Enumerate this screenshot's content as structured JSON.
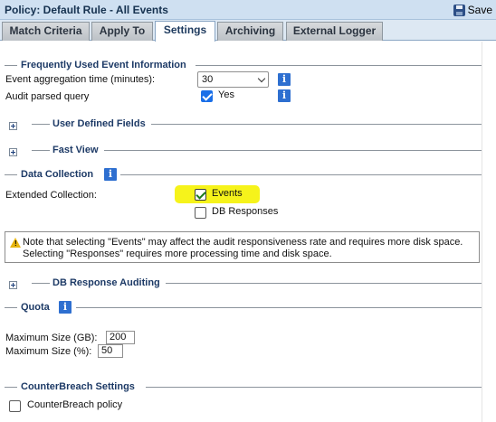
{
  "window": {
    "title": "Policy: Default Rule - All Events",
    "save_label": "Save"
  },
  "tabs": [
    {
      "label": "Match Criteria"
    },
    {
      "label": "Apply To"
    },
    {
      "label": "Settings"
    },
    {
      "label": "Archiving"
    },
    {
      "label": "External Logger"
    }
  ],
  "sections": {
    "frequent": {
      "title": "Frequently Used Event Information",
      "aggregation_label": "Event aggregation time (minutes):",
      "aggregation_value": "30",
      "audit_label": "Audit parsed query",
      "audit_checked": true,
      "audit_value_label": "Yes"
    },
    "user_defined": {
      "title": "User Defined Fields"
    },
    "fast_view": {
      "title": "Fast View"
    },
    "data_collection": {
      "title": "Data Collection",
      "extended_label": "Extended Collection:",
      "options": [
        {
          "label": "Events",
          "checked": true
        },
        {
          "label": "DB Responses",
          "checked": false
        }
      ]
    },
    "note": {
      "text": "Note that selecting \"Events\" may affect the audit responsiveness rate and requires more disk space. Selecting \"Responses\" requires more processing time and disk space."
    },
    "db_response": {
      "title": "DB Response Auditing"
    },
    "quota": {
      "title": "Quota",
      "max_gb_label": "Maximum Size (GB):",
      "max_gb_value": "200",
      "max_pct_label": "Maximum Size (%):",
      "max_pct_value": "50"
    },
    "counterbreach": {
      "title": "CounterBreach Settings",
      "policy_label": "CounterBreach policy",
      "policy_checked": false
    }
  },
  "colors": {
    "title_bar": "#cfe0f1",
    "legend_text": "#1d3a66",
    "info_icon": "#2e6fd0",
    "highlight": "#f6f31b"
  }
}
